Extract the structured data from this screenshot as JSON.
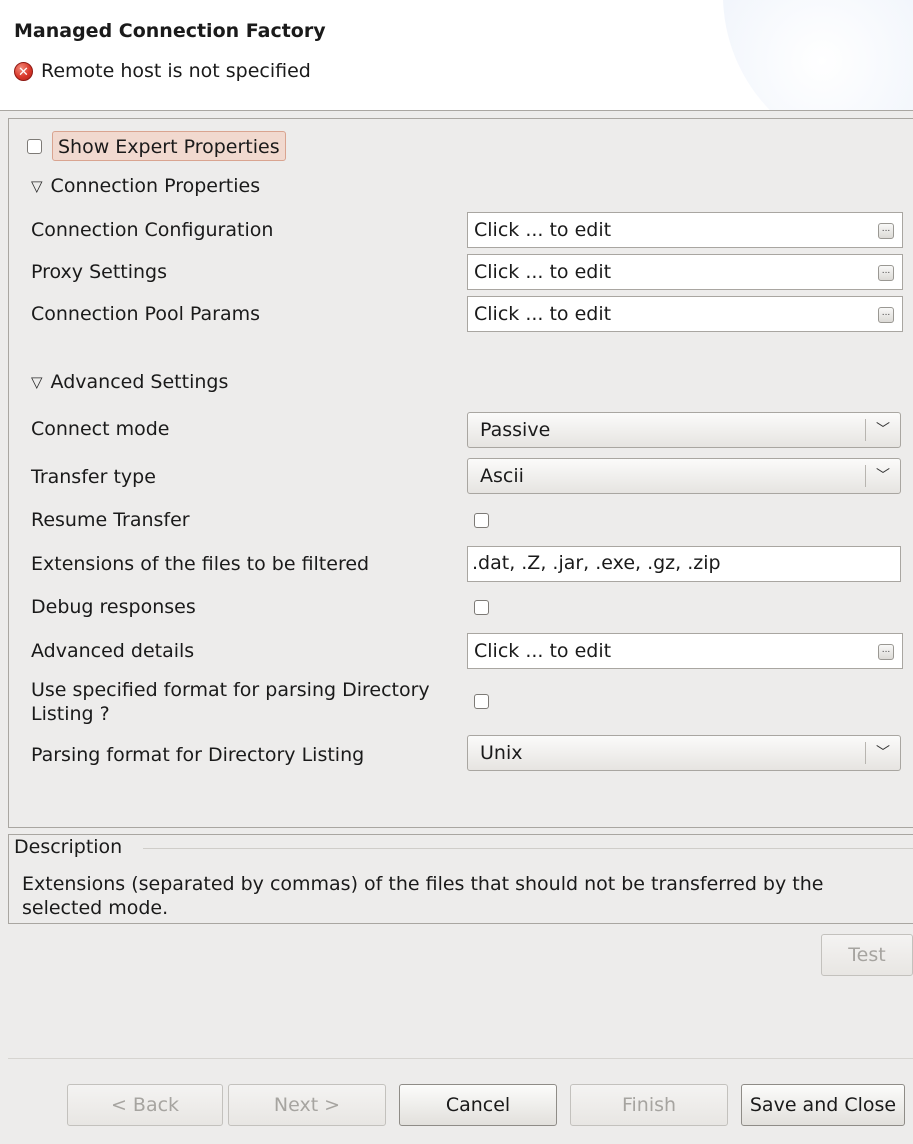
{
  "header": {
    "title": "Managed Connection Factory",
    "status_message": "Remote host is not specified"
  },
  "expert": {
    "label": "Show Expert Properties",
    "checked": false
  },
  "connection_section": {
    "title": "Connection Properties",
    "rows": [
      {
        "label": "Connection Configuration",
        "value": "Click ... to edit"
      },
      {
        "label": "Proxy Settings",
        "value": "Click ... to edit"
      },
      {
        "label": "Connection Pool Params",
        "value": "Click ... to edit"
      }
    ]
  },
  "advanced_section": {
    "title": "Advanced Settings",
    "connect_mode": {
      "label": "Connect mode",
      "value": "Passive"
    },
    "transfer_type": {
      "label": "Transfer type",
      "value": "Ascii"
    },
    "resume_transfer": {
      "label": "Resume Transfer",
      "checked": false
    },
    "extensions": {
      "label": "Extensions of the files to be filtered",
      "value": ".dat, .Z, .jar, .exe, .gz, .zip"
    },
    "debug_responses": {
      "label": "Debug responses",
      "checked": false
    },
    "advanced_details": {
      "label": "Advanced details",
      "value": "Click ... to edit"
    },
    "use_format": {
      "label_line1": "Use specified format for parsing Directory",
      "label_line2": "Listing ?",
      "checked": false
    },
    "parsing_format": {
      "label": "Parsing format for Directory Listing",
      "value": "Unix"
    }
  },
  "description": {
    "title": "Description",
    "text_line1": "Extensions (separated by commas) of the files that should not be transferred by the",
    "text_line2": "selected mode."
  },
  "buttons": {
    "test": "Test",
    "back": "< Back",
    "next": "Next >",
    "cancel": "Cancel",
    "finish": "Finish",
    "save_close": "Save and Close"
  },
  "colors": {
    "background": "#edeceb",
    "error": "#d9382a",
    "expert_highlight": "#f1d9cf"
  },
  "icons": {
    "status": "error-icon",
    "expand": "triangle-down-icon",
    "ellipsis": "ellipsis-button-icon",
    "dropdown": "chevron-down-icon"
  }
}
